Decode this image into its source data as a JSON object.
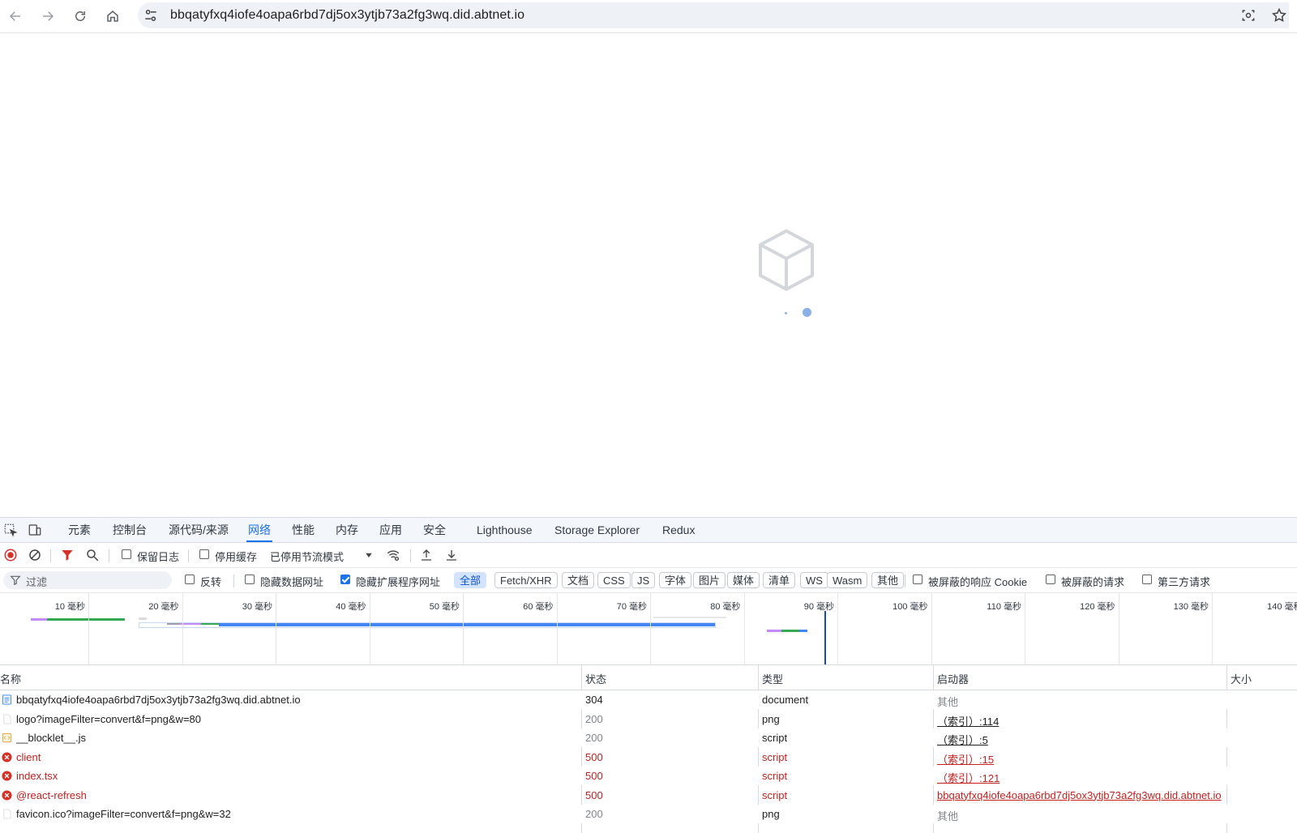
{
  "browser": {
    "url": "bbqatyfxq4iofe4oapa6rbd7dj5ox3ytjb73a2fg3wq.did.abtnet.io"
  },
  "devtools": {
    "tabs": [
      "元素",
      "控制台",
      "源代码/来源",
      "网络",
      "性能",
      "内存",
      "应用",
      "安全",
      "Lighthouse",
      "Storage Explorer",
      "Redux"
    ],
    "active_tab": "网络",
    "toolbar": {
      "preserve_log": "保留日志",
      "disable_cache": "停用缓存",
      "throttle": "已停用节流模式"
    },
    "filter_bar": {
      "filter_placeholder": "过滤",
      "invert": "反转",
      "hide_data_urls": "隐藏数据网址",
      "hide_extension_urls": "隐藏扩展程序网址",
      "types": [
        "全部",
        "Fetch/XHR",
        "文档",
        "CSS",
        "JS",
        "字体",
        "图片",
        "媒体",
        "清单",
        "WS",
        "Wasm",
        "其他"
      ],
      "active_type": "全部",
      "blocked_cookies": "被屏蔽的响应 Cookie",
      "blocked_requests": "被屏蔽的请求",
      "third_party": "第三方请求"
    },
    "timeline": {
      "ticks": [
        "10 毫秒",
        "20 毫秒",
        "30 毫秒",
        "40 毫秒",
        "50 毫秒",
        "60 毫秒",
        "70 毫秒",
        "80 毫秒",
        "90 毫秒",
        "100 毫秒",
        "110 毫秒",
        "120 毫秒",
        "130 毫秒",
        "140 毫秒"
      ]
    },
    "table": {
      "columns": [
        "名称",
        "状态",
        "类型",
        "启动器",
        "大小"
      ],
      "rows": [
        {
          "name": "bbqatyfxq4iofe4oapa6rbd7dj5ox3ytjb73a2fg3wq.did.abtnet.io",
          "status": "304",
          "type": "document",
          "initiator": "其他",
          "kind": "doc"
        },
        {
          "name": "logo?imageFilter=convert&f=png&w=80",
          "status": "200",
          "type": "png",
          "initiator": "（索引）:114",
          "kind": "img"
        },
        {
          "name": "__blocklet__.js",
          "status": "200",
          "type": "script",
          "initiator": "（索引）:5",
          "kind": "script"
        },
        {
          "name": "client",
          "status": "500",
          "type": "script",
          "initiator": "（索引）:15",
          "kind": "error"
        },
        {
          "name": "index.tsx",
          "status": "500",
          "type": "script",
          "initiator": "（索引）:121",
          "kind": "error"
        },
        {
          "name": "@react-refresh",
          "status": "500",
          "type": "script",
          "initiator": "bbqatyfxq4iofe4oapa6rbd7dj5ox3ytjb73a2fg3wq.did.abtnet.io",
          "kind": "error"
        },
        {
          "name": "favicon.ico?imageFilter=convert&f=png&w=32",
          "status": "200",
          "type": "png",
          "initiator": "其他",
          "kind": "img"
        }
      ]
    }
  }
}
